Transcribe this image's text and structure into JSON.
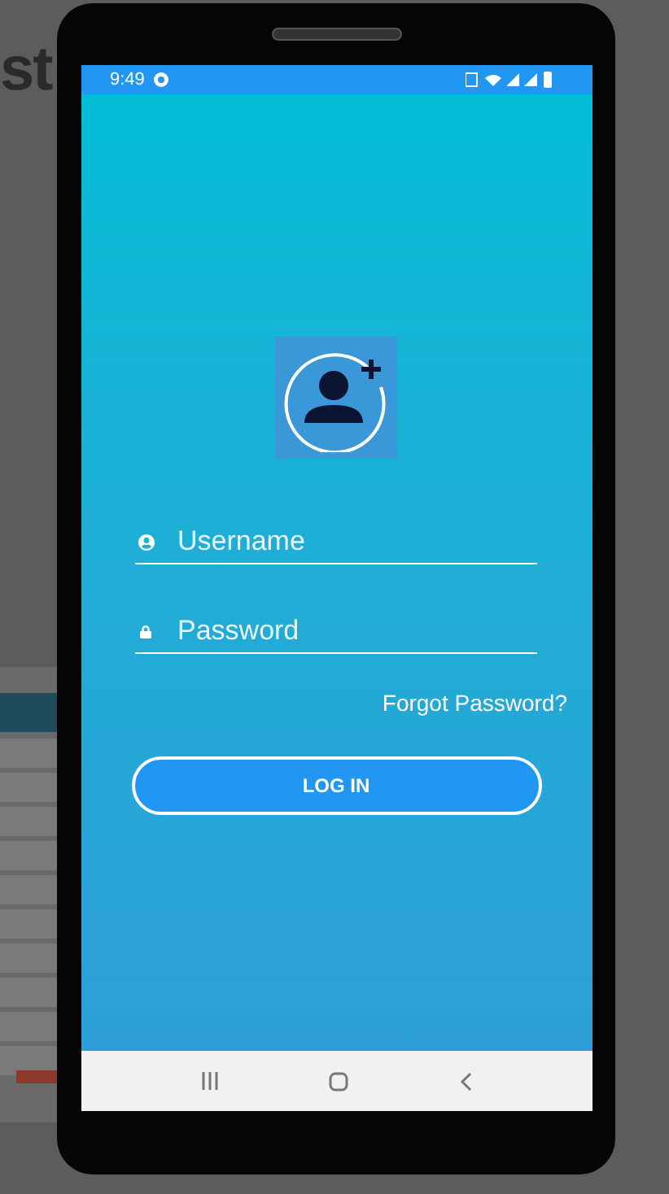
{
  "background_heading": "st",
  "status_bar": {
    "time": "9:49"
  },
  "username": {
    "placeholder": "Username"
  },
  "password": {
    "placeholder": "Password"
  },
  "forgot_password": "Forgot Password?",
  "login_button": "LOG IN"
}
